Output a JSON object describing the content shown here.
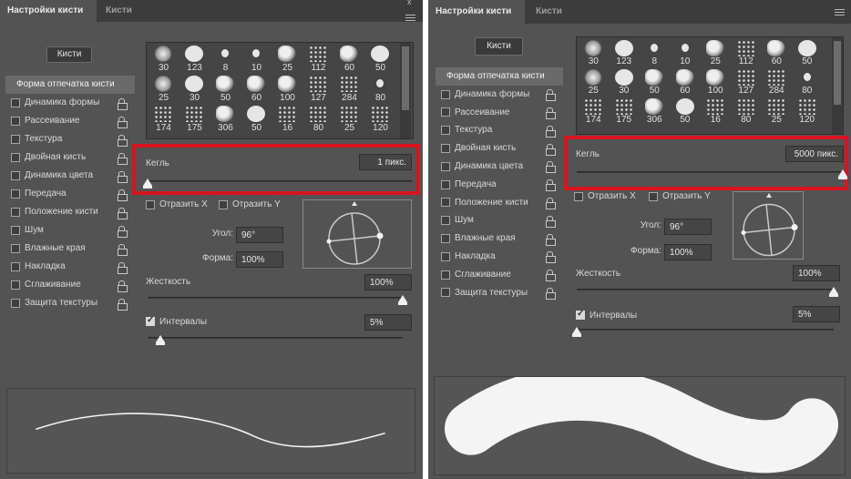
{
  "panels": [
    {
      "tabs": [
        "Настройки кисти",
        "Кисти"
      ],
      "brushes_button": "Кисти",
      "top_glyph": "x",
      "sidebar": [
        {
          "label": "Форма отпечатка кисти",
          "checkbox": false,
          "lock": false,
          "active": true
        },
        {
          "label": "Динамика формы",
          "checkbox": true,
          "lock": true,
          "active": false
        },
        {
          "label": "Рассеивание",
          "checkbox": true,
          "lock": true,
          "active": false
        },
        {
          "label": "Текстура",
          "checkbox": true,
          "lock": true,
          "active": false
        },
        {
          "label": "Двойная кисть",
          "checkbox": true,
          "lock": true,
          "active": false
        },
        {
          "label": "Динамика цвета",
          "checkbox": true,
          "lock": true,
          "active": false
        },
        {
          "label": "Передача",
          "checkbox": true,
          "lock": true,
          "active": false
        },
        {
          "label": "Положение кисти",
          "checkbox": true,
          "lock": true,
          "active": false
        },
        {
          "label": "Шум",
          "checkbox": true,
          "lock": true,
          "active": false
        },
        {
          "label": "Влажные края",
          "checkbox": true,
          "lock": true,
          "active": false
        },
        {
          "label": "Накладка",
          "checkbox": true,
          "lock": true,
          "active": false
        },
        {
          "label": "Сглаживание",
          "checkbox": true,
          "lock": true,
          "active": false
        },
        {
          "label": "Защита текстуры",
          "checkbox": true,
          "lock": true,
          "active": false
        }
      ],
      "brush_tips": [
        {
          "size": "30",
          "style": "soft"
        },
        {
          "size": "123",
          "style": "hard"
        },
        {
          "size": "8",
          "style": "small"
        },
        {
          "size": "10",
          "style": "small"
        },
        {
          "size": "25",
          "style": "spat"
        },
        {
          "size": "112",
          "style": "dots"
        },
        {
          "size": "60",
          "style": "spat"
        },
        {
          "size": "50",
          "style": "hard"
        },
        {
          "size": "25",
          "style": "soft"
        },
        {
          "size": "30",
          "style": "hard"
        },
        {
          "size": "50",
          "style": "spat"
        },
        {
          "size": "60",
          "style": "spat"
        },
        {
          "size": "100",
          "style": "spat"
        },
        {
          "size": "127",
          "style": "dots"
        },
        {
          "size": "284",
          "style": "dots"
        },
        {
          "size": "80",
          "style": "small"
        },
        {
          "size": "174",
          "style": "dots"
        },
        {
          "size": "175",
          "style": "dots"
        },
        {
          "size": "306",
          "style": "spat"
        },
        {
          "size": "50",
          "style": "hard"
        },
        {
          "size": "16",
          "style": "dots"
        },
        {
          "size": "80",
          "style": "dots"
        },
        {
          "size": "25",
          "style": "dots"
        },
        {
          "size": "120",
          "style": "dots"
        }
      ],
      "size": {
        "label": "Кегль",
        "value": "1 пикс.",
        "slider": 0.0
      },
      "flip_x": "Отразить X",
      "flip_y": "Отразить Y",
      "angle": {
        "label": "Угол:",
        "value": "96°"
      },
      "roundness": {
        "label": "Форма:",
        "value": "100%"
      },
      "hardness": {
        "label": "Жесткость",
        "value": "100%",
        "slider": 1.0
      },
      "spacing": {
        "label": "Интервалы",
        "value": "5%",
        "checked": true,
        "slider": 0.05
      },
      "stroke_preview": "thin"
    },
    {
      "tabs": [
        "Настройки кисти",
        "Кисти"
      ],
      "brushes_button": "Кисти",
      "top_glyph": "",
      "sidebar": [
        {
          "label": "Форма отпечатка кисти",
          "checkbox": false,
          "lock": false,
          "active": true
        },
        {
          "label": "Динамика формы",
          "checkbox": true,
          "lock": true,
          "active": false
        },
        {
          "label": "Рассеивание",
          "checkbox": true,
          "lock": true,
          "active": false
        },
        {
          "label": "Текстура",
          "checkbox": true,
          "lock": true,
          "active": false
        },
        {
          "label": "Двойная кисть",
          "checkbox": true,
          "lock": true,
          "active": false
        },
        {
          "label": "Динамика цвета",
          "checkbox": true,
          "lock": true,
          "active": false
        },
        {
          "label": "Передача",
          "checkbox": true,
          "lock": true,
          "active": false
        },
        {
          "label": "Положение кисти",
          "checkbox": true,
          "lock": true,
          "active": false
        },
        {
          "label": "Шум",
          "checkbox": true,
          "lock": true,
          "active": false
        },
        {
          "label": "Влажные края",
          "checkbox": true,
          "lock": true,
          "active": false
        },
        {
          "label": "Накладка",
          "checkbox": true,
          "lock": true,
          "active": false
        },
        {
          "label": "Сглаживание",
          "checkbox": true,
          "lock": true,
          "active": false
        },
        {
          "label": "Защита текстуры",
          "checkbox": true,
          "lock": true,
          "active": false
        }
      ],
      "brush_tips": [
        {
          "size": "30",
          "style": "soft"
        },
        {
          "size": "123",
          "style": "hard"
        },
        {
          "size": "8",
          "style": "small"
        },
        {
          "size": "10",
          "style": "small"
        },
        {
          "size": "25",
          "style": "spat"
        },
        {
          "size": "112",
          "style": "dots"
        },
        {
          "size": "60",
          "style": "spat"
        },
        {
          "size": "50",
          "style": "hard"
        },
        {
          "size": "25",
          "style": "soft"
        },
        {
          "size": "30",
          "style": "hard"
        },
        {
          "size": "50",
          "style": "spat"
        },
        {
          "size": "60",
          "style": "spat"
        },
        {
          "size": "100",
          "style": "spat"
        },
        {
          "size": "127",
          "style": "dots"
        },
        {
          "size": "284",
          "style": "dots"
        },
        {
          "size": "80",
          "style": "small"
        },
        {
          "size": "174",
          "style": "dots"
        },
        {
          "size": "175",
          "style": "dots"
        },
        {
          "size": "306",
          "style": "spat"
        },
        {
          "size": "50",
          "style": "hard"
        },
        {
          "size": "16",
          "style": "dots"
        },
        {
          "size": "80",
          "style": "dots"
        },
        {
          "size": "25",
          "style": "dots"
        },
        {
          "size": "120",
          "style": "dots"
        }
      ],
      "size": {
        "label": "Кегль",
        "value": "5000 пикс.",
        "slider": 1.0
      },
      "flip_x": "Отразить X",
      "flip_y": "Отразить Y",
      "angle": {
        "label": "Угол:",
        "value": "96°"
      },
      "roundness": {
        "label": "Форма:",
        "value": "100%"
      },
      "hardness": {
        "label": "Жесткость",
        "value": "100%",
        "slider": 1.0
      },
      "spacing": {
        "label": "Интервалы",
        "value": "5%",
        "checked": true,
        "slider": 0.0
      },
      "stroke_preview": "thick"
    }
  ],
  "colors": {
    "highlight": "#d8141e",
    "panel": "#535353",
    "tabbar": "#3c3c3c"
  }
}
